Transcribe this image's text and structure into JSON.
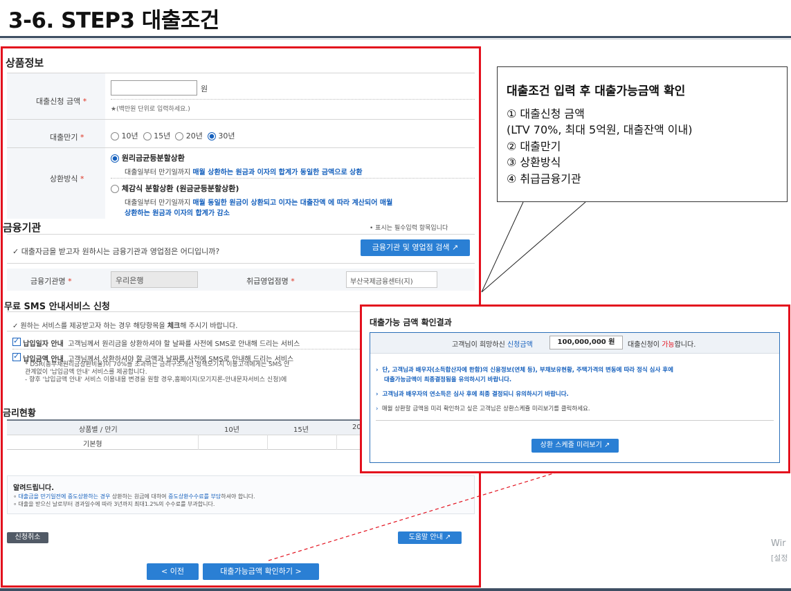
{
  "slide": {
    "title": "3-6. STEP3 대출조건"
  },
  "product": {
    "section_title": "상품정보",
    "amount_label": "대출신청 금액",
    "required_mark": "*",
    "amount_value": "",
    "amount_unit": "원",
    "amount_hint": "★(백만원 단위로 입력하세요.)",
    "term_label": "대출만기",
    "terms": [
      "10년",
      "15년",
      "20년",
      "30년"
    ],
    "term_selected": "30년",
    "repay_label": "상환방식",
    "repay_options": [
      {
        "title": "원리금균등분할상환",
        "desc_plain": "대출일부터 만기일까지 ",
        "desc_blue": "매월 상환하는 원금과 이자의 합계가 동일한 금액으로 상환",
        "desc_blue2": ""
      },
      {
        "title": "체감식 분할상환 (원금균등분할상환)",
        "desc_plain": "대출일부터 만기일까지 ",
        "desc_blue": "매월 동일한 원금이 상환되고 이자는 대출잔액 에 따라 계산되어 매월",
        "desc_blue2": "상환하는 원금과 이자의 합계가 감소"
      }
    ]
  },
  "bank": {
    "section_title": "금융기관",
    "required_note": "• 표시는 필수입력 항목입니다",
    "question": "✓ 대출자금을 받고자 원하시는 금융기관과 영업점은 어디입니까?",
    "search_button": "금융기관 및 영업점 검색 ↗",
    "bank_label": "금융기관명",
    "bank_value": "우리은행",
    "branch_label": "취급영업점명",
    "branch_value": "부산국제금융센터(지)"
  },
  "sms": {
    "section_title": "무료 SMS 안내서비스 신청",
    "guide_prefix": "✓ 원하는 서비스를 제공받고자 하는 경우 해당항목을 ",
    "guide_bold": "체크",
    "guide_suffix": "해 주시기 바랍니다.",
    "opt1_title": "납입일자 안내",
    "opt1_desc": "고객님께서 원리금을 상환하셔야 할 날짜를 사전에 SMS로 안내해 드리는 서비스",
    "opt2_title": "납입금액 안내",
    "opt2_desc": "고객님께서 상환하셔야 할 금액과 날짜를 사전에 SMS로 안내해 드리는 서비스",
    "opt2_note1": "* DSR(총부채원리금상환비율)이 70%를 초과하는 금리구조개선 정책모기지 이용고객에게는 SMS 안",
    "opt2_note2": "관계없이 '납입금액 안내' 서비스를 제공합니다.",
    "opt2_note3": "- 향후 '납입금액 안내' 서비스 이용내용 변경을 원할 경우,홈페이지(모기지론-안내문자서비스 신청)에"
  },
  "rate": {
    "section_title": "금리현황",
    "columns": [
      "상품별 / 만기",
      "10년",
      "15년",
      "20"
    ],
    "row_label": "기본형",
    "paren_mark": "("
  },
  "notice": {
    "title": "알려드립니다.",
    "line1_pre": "∘ ",
    "line1_blue": "대출금을 만기일전에 중도상환하는 경우",
    "line1_mid": " 상환하는 원금에 대하여 ",
    "line1_blue2": "중도상환수수료를 부담",
    "line1_post": "하셔야 합니다.",
    "line2": "∘ 대출을 받으신 날로부터 경과일수에 따라 3년까지 최대1.2%의 수수료를 부과합니다."
  },
  "bottom": {
    "cancel_button": "신청취소",
    "help_button": "도움말 안내 ↗",
    "prev_button": "< 이전",
    "next_button": "대출가능금액 확인하기 >"
  },
  "callout": {
    "title": "대출조건 입력 후 대출가능금액 확인",
    "lines": [
      "① 대출신청 금액",
      "(LTV 70%, 최대 5억원, 대출잔액 이내)",
      "② 대출만기",
      "③ 상환방식",
      "④ 취급금융기관"
    ]
  },
  "result": {
    "title": "대출가능 금액 확인결과",
    "msg_pre": "고객님이 희망하신 ",
    "msg_blue": "신청금액",
    "amount": "100,000,000 원",
    "msg_mid": "대출신청이 ",
    "msg_red": "가능",
    "msg_post": "합니다.",
    "bullet1_a": "단, 고객님과 배우자(소득합산자에 한함)의 신용정보(연체 등), 부채보유현황, 주택가격의 변동에 따라 정식 심사 후에",
    "bullet1_b": "대출가능금액이 최종결정됨을 유의하시기 바랍니다.",
    "bullet2": "고객님과 배우자의 연소득은 심사 후에 최종 결정되니 유의하시기 바랍니다.",
    "bullet3": "매월 상환할 금액을 미리 확인하고 싶은 고객님은 상환스케쥴 미리보기를 클릭하세요.",
    "schedule_button": "상환 스케줄 미리보기 ↗"
  },
  "watermark": {
    "line1": "Wir",
    "line2": "[설정"
  },
  "colors": {
    "red_frame": "#e3101d",
    "accent_blue": "#2a7fd4",
    "title_bar": "#3e4f63"
  }
}
